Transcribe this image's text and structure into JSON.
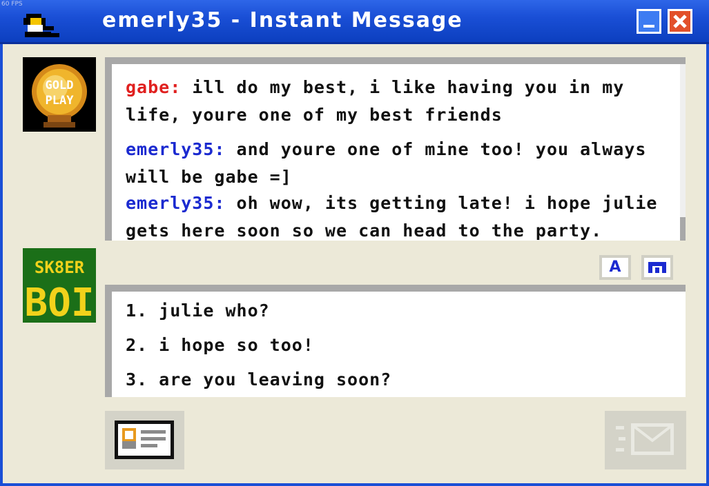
{
  "fps_label": "60 FPS",
  "window": {
    "title": "emerly35 - Instant Message",
    "minimize_icon": "minimize-icon",
    "close_icon": "close-icon"
  },
  "avatars": {
    "buddy": {
      "icon": "gold-play-badge-icon",
      "text": [
        "GOLD",
        "PLAY"
      ]
    },
    "self": {
      "icon": "sk8er-boi-icon",
      "text": [
        "SK8ER",
        "BOI"
      ]
    }
  },
  "chat": {
    "messages": [
      {
        "sender": "gabe:",
        "text": " ill do my best, i like having you in my life, youre one of my best friends"
      },
      {
        "sender": "emerly35:",
        "text": " and youre one of mine too! you always will be gabe =]"
      },
      {
        "sender": "emerly35:",
        "text": " oh wow, its getting late! i hope julie gets here soon so we can head to the party."
      }
    ]
  },
  "format_buttons": [
    {
      "label": "A",
      "icon": "font-icon"
    },
    {
      "label": "",
      "icon": "smiley-icon"
    }
  ],
  "reply_options": [
    "1. julie who?",
    "2. i hope so too!",
    "3. are you leaving soon?"
  ],
  "buttons": {
    "profile_icon": "profile-card-icon",
    "send_icon": "send-mail-icon"
  },
  "colors": {
    "title_bar": "#1a4fd6",
    "buddy_name": "#e0201f",
    "self_name": "#1b2ad0",
    "background": "#ece9d8"
  }
}
